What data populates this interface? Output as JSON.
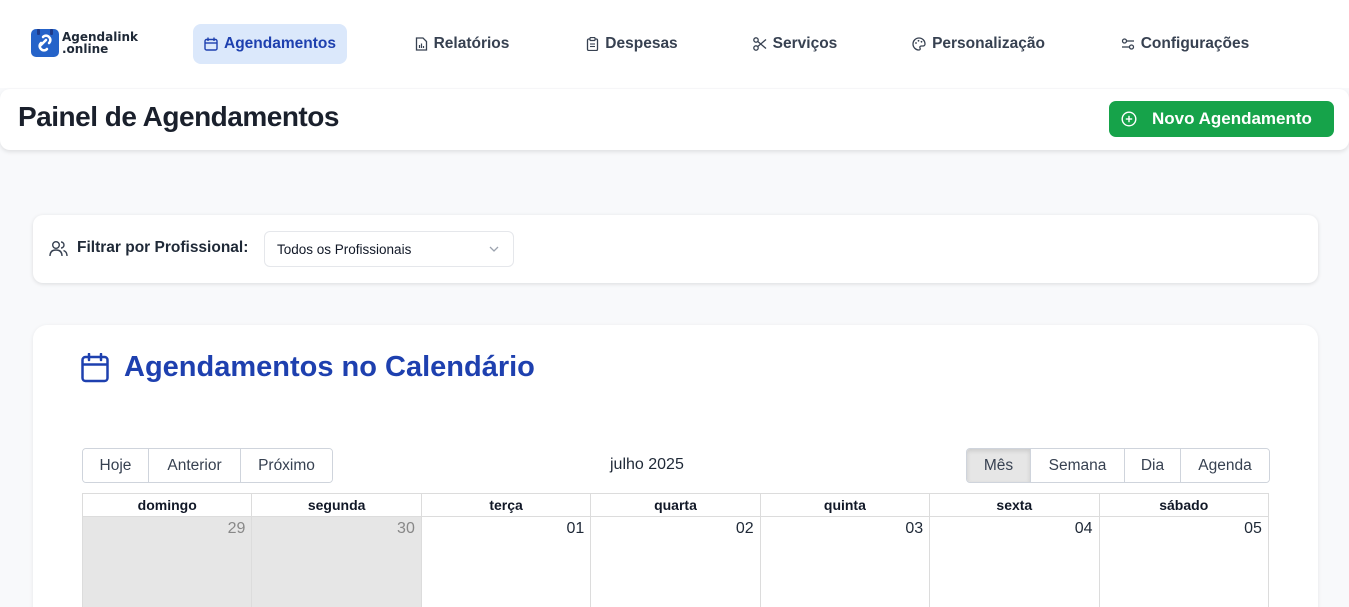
{
  "app": {
    "logo_line1": "Agendalink",
    "logo_line2": ".online"
  },
  "nav": {
    "items": [
      {
        "label": "Agendamentos",
        "icon": "calendar-icon",
        "active": true
      },
      {
        "label": "Relatórios",
        "icon": "report-icon"
      },
      {
        "label": "Despesas",
        "icon": "clipboard-icon"
      },
      {
        "label": "Serviços",
        "icon": "scissors-icon"
      },
      {
        "label": "Personalização",
        "icon": "palette-icon"
      },
      {
        "label": "Configurações",
        "icon": "sliders-icon"
      }
    ]
  },
  "header": {
    "title": "Painel de Agendamentos",
    "new_button": "Novo Agendamento"
  },
  "filter": {
    "label": "Filtrar por Profissional:",
    "selected": "Todos os Profissionais"
  },
  "calendar": {
    "title": "Agendamentos no Calendário",
    "nav_buttons": [
      "Hoje",
      "Anterior",
      "Próximo"
    ],
    "period_label": "julho 2025",
    "views": [
      "Mês",
      "Semana",
      "Dia",
      "Agenda"
    ],
    "active_view": "Mês",
    "weekdays": [
      "domingo",
      "segunda",
      "terça",
      "quarta",
      "quinta",
      "sexta",
      "sábado"
    ],
    "first_week": [
      {
        "day": "29",
        "off": true
      },
      {
        "day": "30",
        "off": true
      },
      {
        "day": "01"
      },
      {
        "day": "02"
      },
      {
        "day": "03"
      },
      {
        "day": "04"
      },
      {
        "day": "05"
      }
    ]
  },
  "colors": {
    "accent": "#1e40af",
    "active_nav_bg": "#dbe8fb",
    "new_button_bg": "#16a34a"
  }
}
